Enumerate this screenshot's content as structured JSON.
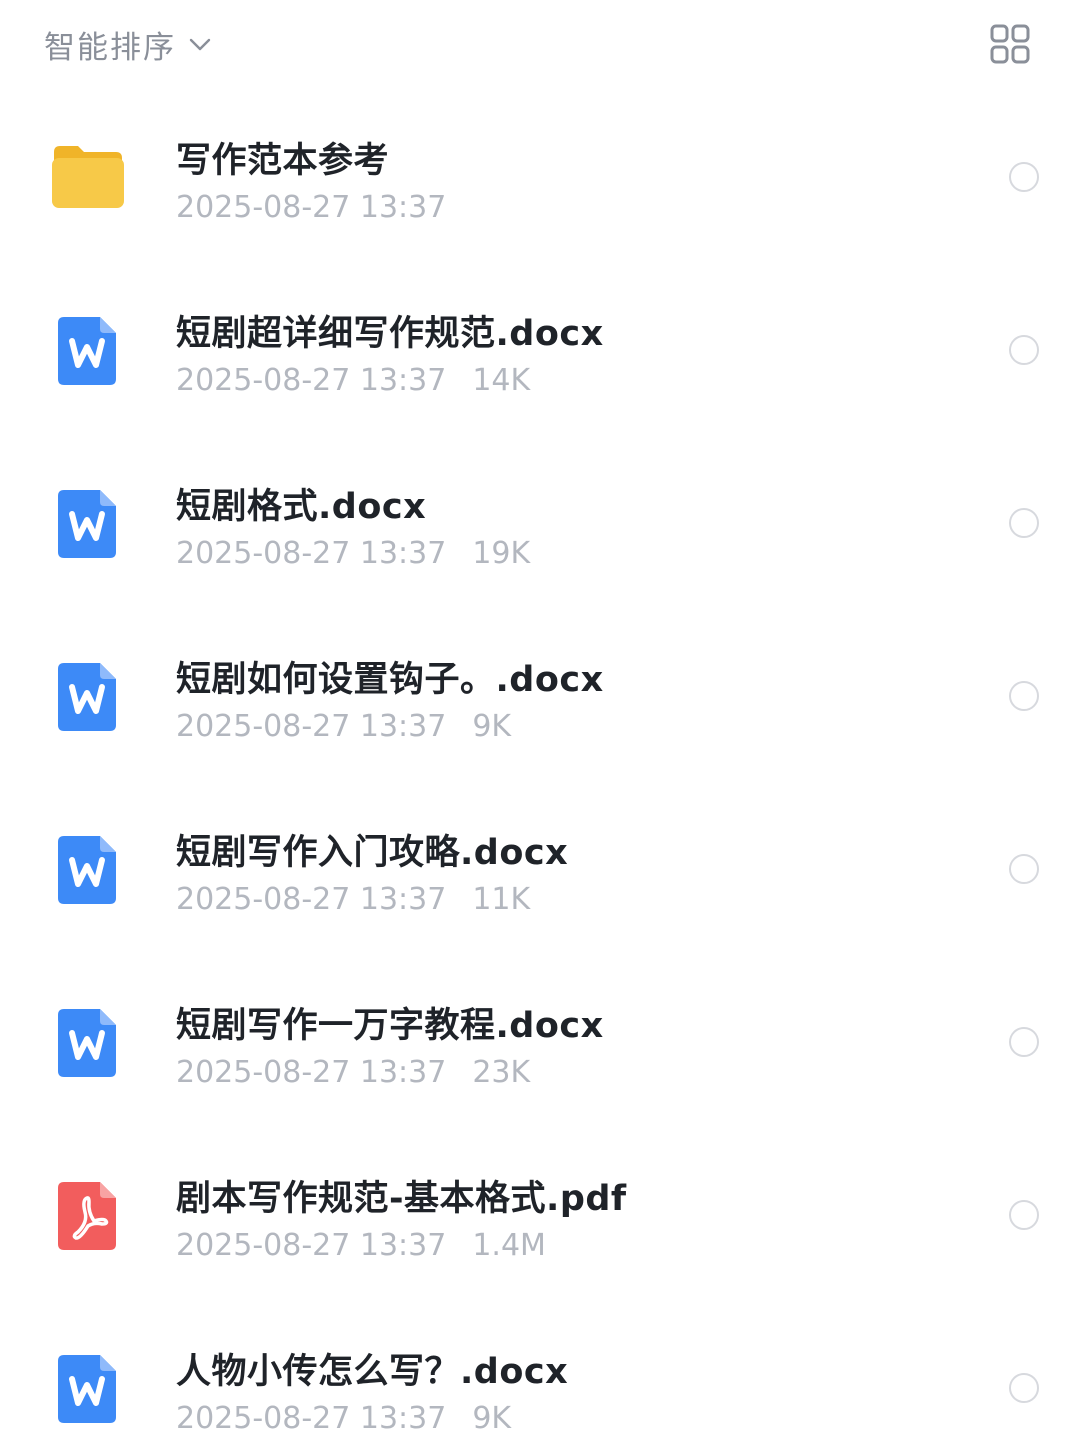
{
  "toolbar": {
    "sort_label": "智能排序",
    "sort_icon": "chevron-down-icon",
    "view_toggle_icon": "grid-view-icon"
  },
  "colors": {
    "folder": "#f7c948",
    "word": "#3d8af7",
    "pdf": "#f25d5d",
    "title_text": "#1f2329",
    "meta_text": "#b3b7bf"
  },
  "files": [
    {
      "type": "folder",
      "icon": "folder-icon",
      "name": "写作范本参考",
      "date": "2025-08-27 13:37",
      "size": ""
    },
    {
      "type": "docx",
      "icon": "word-doc-icon",
      "name": "短剧超详细写作规范.docx",
      "date": "2025-08-27 13:37",
      "size": "14K"
    },
    {
      "type": "docx",
      "icon": "word-doc-icon",
      "name": "短剧格式.docx",
      "date": "2025-08-27 13:37",
      "size": "19K"
    },
    {
      "type": "docx",
      "icon": "word-doc-icon",
      "name": "短剧如何设置钩子。.docx",
      "date": "2025-08-27 13:37",
      "size": "9K"
    },
    {
      "type": "docx",
      "icon": "word-doc-icon",
      "name": "短剧写作入门攻略.docx",
      "date": "2025-08-27 13:37",
      "size": "11K"
    },
    {
      "type": "docx",
      "icon": "word-doc-icon",
      "name": "短剧写作一万字教程.docx",
      "date": "2025-08-27 13:37",
      "size": "23K"
    },
    {
      "type": "pdf",
      "icon": "pdf-icon",
      "name": "剧本写作规范-基本格式.pdf",
      "date": "2025-08-27 13:37",
      "size": "1.4M"
    },
    {
      "type": "docx",
      "icon": "word-doc-icon",
      "name": "人物小传怎么写？.docx",
      "date": "2025-08-27 13:37",
      "size": "9K"
    }
  ]
}
